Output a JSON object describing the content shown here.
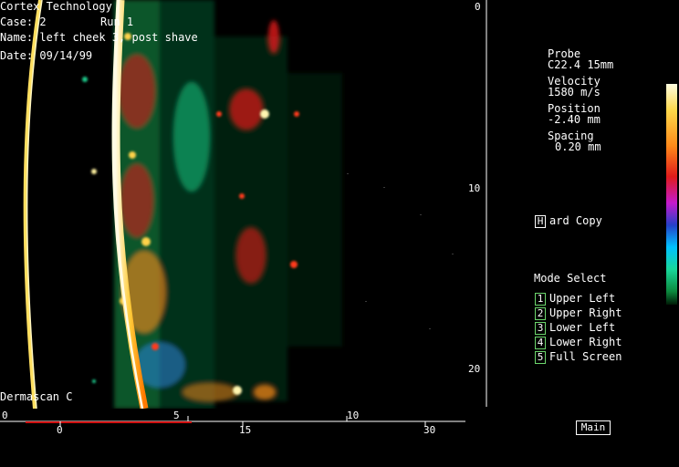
{
  "header": {
    "company": "Cortex Technology",
    "case_label": "Case:",
    "case_value": "2",
    "run_label": "Run",
    "run_value": "1",
    "name_label": "Name:",
    "name_value": "left cheek 3, post shave",
    "date_label": "Date:",
    "date_value": "09/14/99"
  },
  "device": "Dermascan C",
  "depth_axis": {
    "ticks": [
      "0",
      "10",
      "20"
    ]
  },
  "bottom_axis_top": {
    "ticks": [
      "0",
      "5",
      "10"
    ]
  },
  "bottom_axis_bottom": {
    "ticks": [
      "0",
      "15",
      "30"
    ]
  },
  "info": {
    "probe_label": "Probe",
    "probe_value": "C22.4 15mm",
    "velocity_label": "Velocity",
    "velocity_value": "1580 m/s",
    "position_label": "Position",
    "position_value": "-2.40 mm",
    "spacing_label": "Spacing",
    "spacing_value": "0.20 mm"
  },
  "hardcopy": {
    "key": "H",
    "label": "ard Copy"
  },
  "mode_select": {
    "title": "Mode Select",
    "items": [
      {
        "key": "1",
        "label": "Upper Left"
      },
      {
        "key": "2",
        "label": "Upper Right"
      },
      {
        "key": "3",
        "label": "Lower Left"
      },
      {
        "key": "4",
        "label": "Lower Right"
      },
      {
        "key": "5",
        "label": "Full Screen"
      }
    ]
  },
  "main_button": "Main",
  "colors": {
    "background": "#000000",
    "menu_key_border": "#6cd66c",
    "axis_red": "#d01010"
  }
}
